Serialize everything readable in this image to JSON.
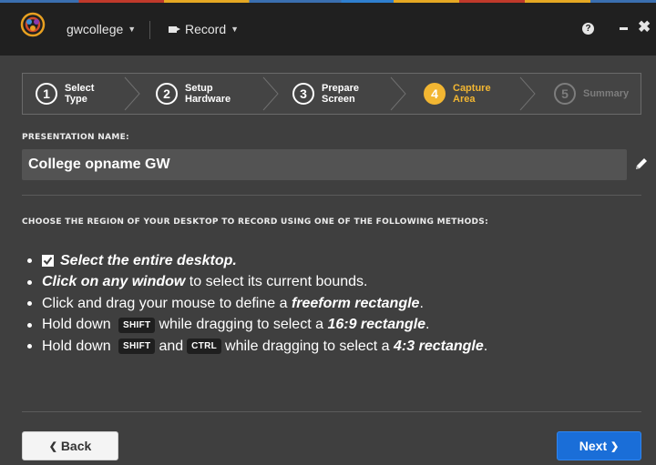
{
  "app": {
    "account_label": "gwcollege",
    "record_label": "Record",
    "help_icon": "question-icon",
    "minimize_icon": "minus-icon",
    "close_icon": "close-icon"
  },
  "wizard": {
    "steps": [
      {
        "number": "1",
        "line1": "Select",
        "line2": "Type",
        "state": "done"
      },
      {
        "number": "2",
        "line1": "Setup",
        "line2": "Hardware",
        "state": "done"
      },
      {
        "number": "3",
        "line1": "Prepare",
        "line2": "Screen",
        "state": "done"
      },
      {
        "number": "4",
        "line1": "Capture",
        "line2": "Area",
        "state": "active"
      },
      {
        "number": "5",
        "line1": "Summary",
        "line2": "",
        "state": "future"
      }
    ],
    "active_color": "#f2b632"
  },
  "presentation": {
    "label": "PRESENTATION NAME:",
    "value": "College opname GW"
  },
  "methods": {
    "heading": "CHOOSE THE REGION OF YOUR DESKTOP TO RECORD USING ONE OF THE FOLLOWING METHODS:",
    "item1": "Select the entire desktop.",
    "item1_checked": true,
    "item2_bold": "Click on any window",
    "item2_rest": " to select its current bounds.",
    "item3_pre": "Click and drag your mouse to define a ",
    "item3_bold": "freeform rectangle",
    "item3_post": ".",
    "item4_pre": "Hold down ",
    "item4_key": "SHIFT",
    "item4_mid": "while dragging to select a ",
    "item4_bold": "16:9 rectangle",
    "item4_post": ".",
    "item5_pre": "Hold down ",
    "item5_key1": "SHIFT",
    "item5_and": "and",
    "item5_key2": "CTRL",
    "item5_mid": "while dragging to select a ",
    "item5_bold": "4:3 rectangle",
    "item5_post": "."
  },
  "footer": {
    "back_label": "Back",
    "next_label": "Next",
    "next_color": "#1a6ed8"
  }
}
